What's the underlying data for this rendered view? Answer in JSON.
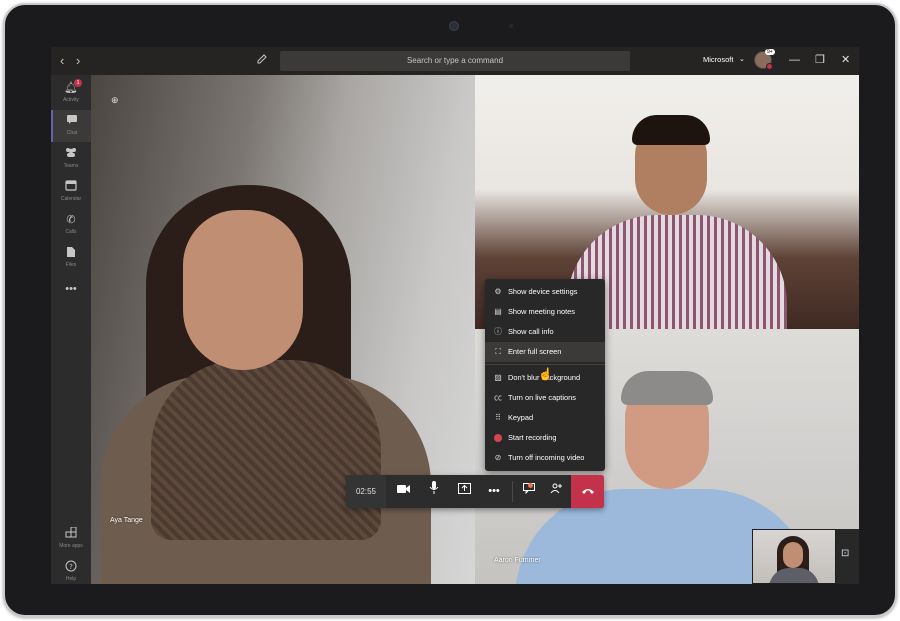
{
  "topbar": {
    "search_placeholder": "Search or type a command",
    "org_name": "Microsoft",
    "avatar_badge": "9+",
    "back_glyph": "‹",
    "forward_glyph": "›"
  },
  "rail": {
    "items": [
      {
        "label": "Activity",
        "icon": "bell-icon",
        "badge": "1"
      },
      {
        "label": "Chat",
        "icon": "chat-icon"
      },
      {
        "label": "Teams",
        "icon": "teams-icon"
      },
      {
        "label": "Calendar",
        "icon": "calendar-icon"
      },
      {
        "label": "Calls",
        "icon": "phone-icon"
      },
      {
        "label": "Files",
        "icon": "file-icon"
      }
    ],
    "more_label": "•••",
    "bottom_items": [
      {
        "label": "More apps",
        "icon": "apps-icon"
      },
      {
        "label": "Help",
        "icon": "help-icon"
      }
    ]
  },
  "participants": [
    {
      "name": "Aya Tange"
    },
    {
      "name": ""
    },
    {
      "name": "Aaron Fummer"
    }
  ],
  "menu": {
    "items": [
      {
        "label": "Show device settings",
        "icon": "gear-icon"
      },
      {
        "label": "Show meeting notes",
        "icon": "notes-icon"
      },
      {
        "label": "Show call info",
        "icon": "info-icon"
      },
      {
        "label": "Enter full screen",
        "icon": "fullscreen-icon"
      },
      {
        "label": "Don't blur background",
        "icon": "blur-icon"
      },
      {
        "label": "Turn on live captions",
        "icon": "captions-icon"
      },
      {
        "label": "Keypad",
        "icon": "keypad-icon"
      },
      {
        "label": "Start recording",
        "icon": "record-icon"
      },
      {
        "label": "Turn off incoming video",
        "icon": "video-off-icon"
      }
    ]
  },
  "callbar": {
    "timer": "02:55"
  },
  "colors": {
    "accent": "#6264a7",
    "hangup": "#c4314b",
    "record": "#d64452"
  }
}
